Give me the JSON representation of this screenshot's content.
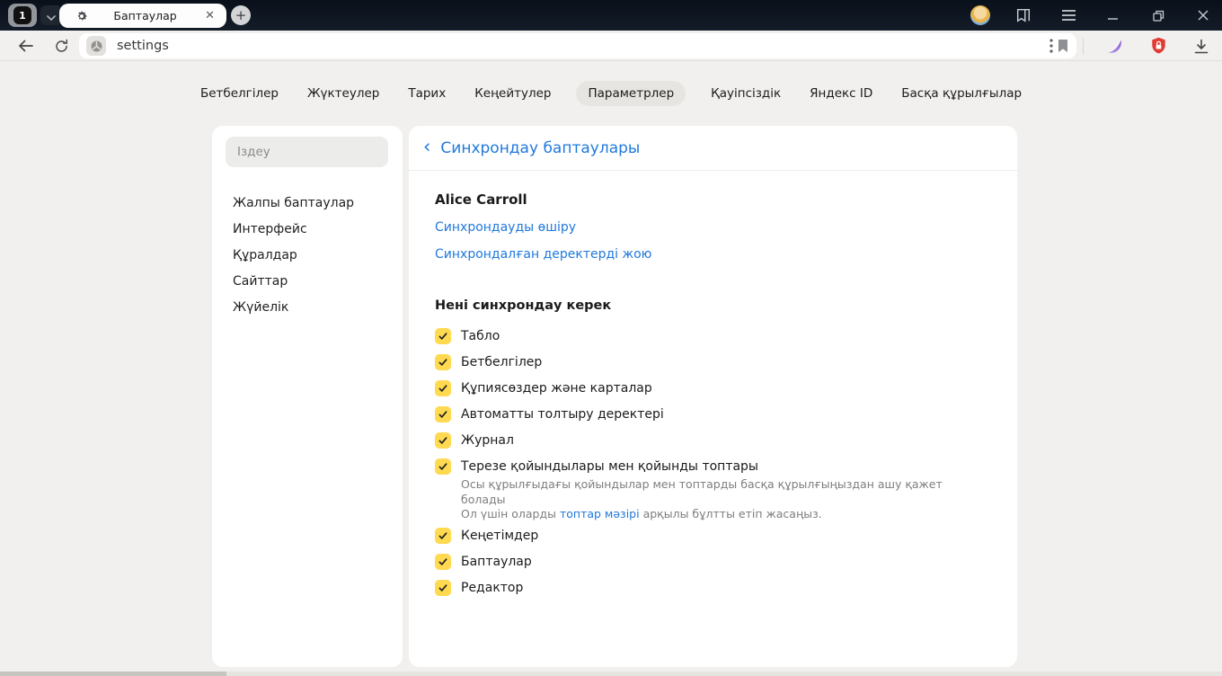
{
  "browser": {
    "tab_counter": "1",
    "tab_title": "Баптаулар",
    "tab_close": "✕",
    "new_tab_label": "+",
    "window_title": "Баптаулар",
    "url_text": "settings"
  },
  "nav_tabs": [
    {
      "label": "Бетбелгілер",
      "selected": false
    },
    {
      "label": "Жүктеулер",
      "selected": false
    },
    {
      "label": "Тарих",
      "selected": false
    },
    {
      "label": "Кеңейтулер",
      "selected": false
    },
    {
      "label": "Параметрлер",
      "selected": true
    },
    {
      "label": "Қауіпсіздік",
      "selected": false
    },
    {
      "label": "Яндекс ID",
      "selected": false
    },
    {
      "label": "Басқа құрылғылар",
      "selected": false
    }
  ],
  "sidebar": {
    "search_placeholder": "Іздеу",
    "items": [
      {
        "label": "Жалпы баптаулар"
      },
      {
        "label": "Интерфейс"
      },
      {
        "label": "Құралдар"
      },
      {
        "label": "Сайттар"
      },
      {
        "label": "Жүйелік"
      }
    ]
  },
  "main": {
    "back_chevron": "‹",
    "title": "Синхрондау баптаулары",
    "account_name": "Alice Carroll",
    "link_disable_sync": "Синхрондауды өшіру",
    "link_delete_synced": "Синхрондалған деректерді жою",
    "section_title": "Нені синхрондау керек",
    "checkboxes": [
      {
        "label": "Табло",
        "checked": true
      },
      {
        "label": "Бетбелгілер",
        "checked": true
      },
      {
        "label": "Құпиясөздер және карталар",
        "checked": true
      },
      {
        "label": "Автоматты толтыру деректері",
        "checked": true
      },
      {
        "label": "Журнал",
        "checked": true
      },
      {
        "label": "Терезе қойындылары мен қойынды топтары",
        "checked": true,
        "description_line1": "Осы құрылғыдағы қойындылар мен топтарды басқа құрылғыңыздан ашу қажет болады",
        "description_line2_prefix": "Ол үшін оларды ",
        "description_link": "топтар мәзірі",
        "description_line2_suffix": " арқылы бұлтты етіп жасаңыз."
      },
      {
        "label": "Кеңетімдер",
        "checked": true
      },
      {
        "label": "Баптаулар",
        "checked": true
      },
      {
        "label": "Редактор",
        "checked": true
      }
    ]
  },
  "colors": {
    "accent_blue": "#2079dd",
    "checkbox_yellow": "#ffd94f",
    "shield_red": "#e13b33",
    "feather_purple": "#8a5fd0"
  }
}
